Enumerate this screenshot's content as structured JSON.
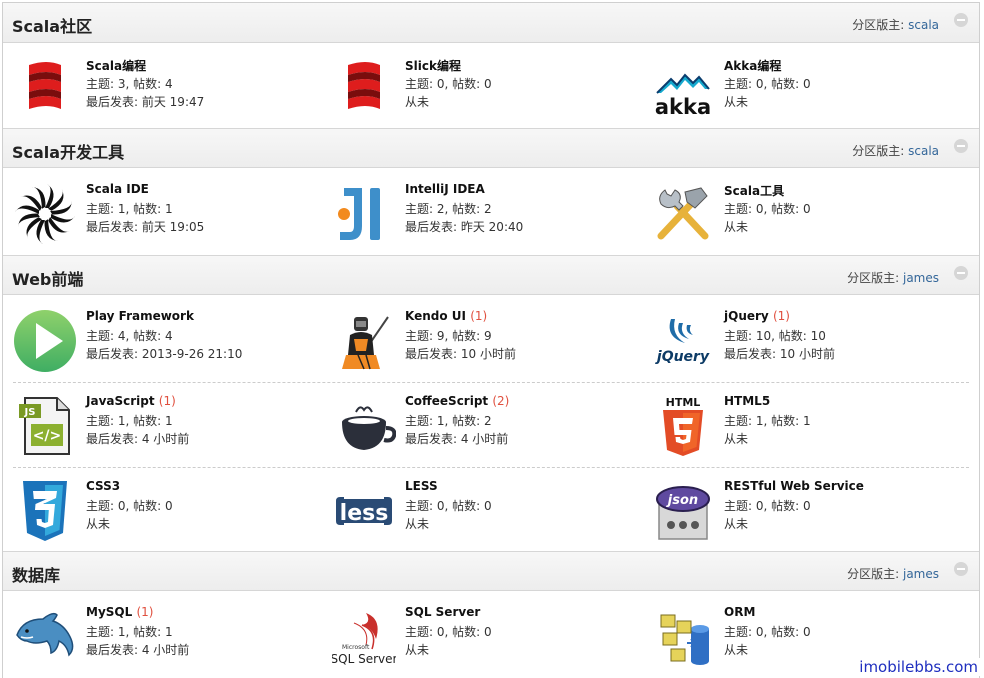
{
  "moderator_label": "分区版主: ",
  "sections": [
    {
      "title": "Scala社区",
      "moderator": "scala",
      "forums": [
        {
          "name": "Scala编程",
          "badge": "",
          "stats": "主题: 3, 帖数: 4",
          "last": "最后发表: 前天 19:47",
          "icon": "scala-logo-icon"
        },
        {
          "name": "Slick编程",
          "badge": "",
          "stats": "主题: 0, 帖数: 0",
          "last": "从未",
          "icon": "scala-logo-icon"
        },
        {
          "name": "Akka编程",
          "badge": "",
          "stats": "主题: 0, 帖数: 0",
          "last": "从未",
          "icon": "akka-logo-icon"
        }
      ]
    },
    {
      "title": "Scala开发工具",
      "moderator": "scala",
      "forums": [
        {
          "name": "Scala IDE",
          "badge": "",
          "stats": "主题: 1, 帖数: 1",
          "last": "最后发表: 前天 19:05",
          "icon": "scala-ide-logo-icon"
        },
        {
          "name": "IntelliJ IDEA",
          "badge": "",
          "stats": "主题: 2, 帖数: 2",
          "last": "最后发表: 昨天 20:40",
          "icon": "intellij-logo-icon"
        },
        {
          "name": "Scala工具",
          "badge": "",
          "stats": "主题: 0, 帖数: 0",
          "last": "从未",
          "icon": "tools-icon"
        }
      ]
    },
    {
      "title": "Web前端",
      "moderator": "james",
      "forums": [
        {
          "name": "Play Framework",
          "badge": "",
          "stats": "主题: 4, 帖数: 4",
          "last": "最后发表: 2013-9-26 21:10",
          "icon": "play-logo-icon"
        },
        {
          "name": "Kendo UI",
          "badge": "(1)",
          "stats": "主题: 9, 帖数: 9",
          "last": "最后发表: 10 小时前",
          "icon": "kendo-logo-icon"
        },
        {
          "name": "jQuery",
          "badge": "(1)",
          "stats": "主题: 10, 帖数: 10",
          "last": "最后发表: 10 小时前",
          "icon": "jquery-logo-icon"
        },
        {
          "name": "JavaScript",
          "badge": "(1)",
          "stats": "主题: 1, 帖数: 1",
          "last": "最后发表: 4 小时前",
          "icon": "js-file-icon"
        },
        {
          "name": "CoffeeScript",
          "badge": "(2)",
          "stats": "主题: 1, 帖数: 2",
          "last": "最后发表: 4 小时前",
          "icon": "coffeescript-logo-icon"
        },
        {
          "name": "HTML5",
          "badge": "",
          "stats": "主题: 1, 帖数: 1",
          "last": "从未",
          "icon": "html5-logo-icon"
        },
        {
          "name": "CSS3",
          "badge": "",
          "stats": "主题: 0, 帖数: 0",
          "last": "从未",
          "icon": "css3-logo-icon"
        },
        {
          "name": "LESS",
          "badge": "",
          "stats": "主题: 0, 帖数: 0",
          "last": "从未",
          "icon": "less-logo-icon"
        },
        {
          "name": "RESTful Web Service",
          "badge": "",
          "stats": "主题: 0, 帖数: 0",
          "last": "从未",
          "icon": "json-logo-icon"
        }
      ]
    },
    {
      "title": "数据库",
      "moderator": "james",
      "forums": [
        {
          "name": "MySQL",
          "badge": "(1)",
          "stats": "主题: 1, 帖数: 1",
          "last": "最后发表: 4 小时前",
          "icon": "mysql-logo-icon"
        },
        {
          "name": "SQL Server",
          "badge": "",
          "stats": "主题: 0, 帖数: 0",
          "last": "从未",
          "icon": "sqlserver-logo-icon"
        },
        {
          "name": "ORM",
          "badge": "",
          "stats": "主题: 0, 帖数: 0",
          "last": "从未",
          "icon": "orm-logo-icon"
        }
      ]
    }
  ],
  "logo_text": {
    "akka": "akka",
    "js": "JS",
    "html": "HTML",
    "less": "less",
    "json": "json",
    "sqlserver_small": "Microsoft",
    "sqlserver": "SQL Server",
    "jquery": "jQuery"
  },
  "watermark": "imobilebbs.com",
  "colors": {
    "badge": "#e0503f",
    "moderator_link": "#336699",
    "watermark": "#1f2fbf"
  }
}
